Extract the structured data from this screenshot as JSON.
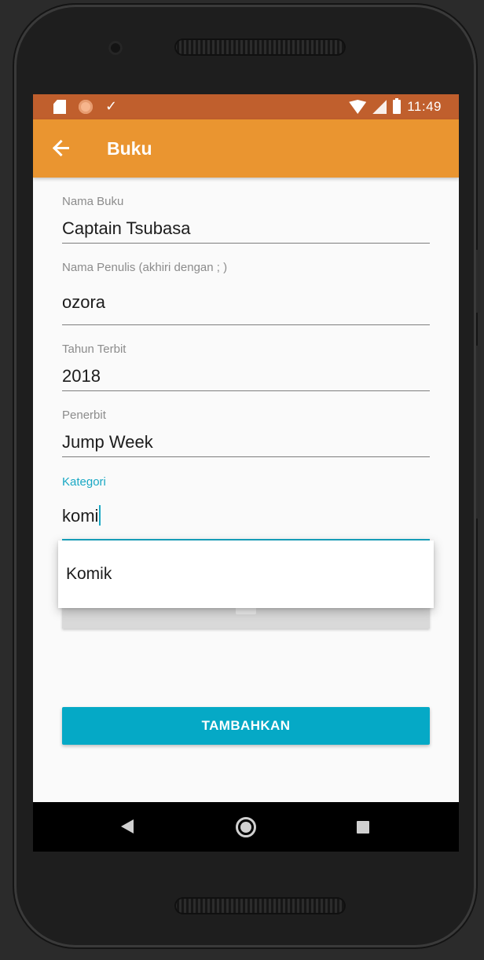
{
  "status_bar": {
    "time": "11:49",
    "icons": [
      "sd-card-icon",
      "sync-icon",
      "check-icon",
      "wifi-icon",
      "signal-icon",
      "battery-icon"
    ]
  },
  "app_bar": {
    "title": "Buku",
    "back_icon": "back-arrow-icon",
    "color": "#ea9530",
    "status_color": "#c05f2d"
  },
  "form": {
    "fields": [
      {
        "label": "Nama Buku",
        "value": "Captain Tsubasa"
      },
      {
        "label": "Nama Penulis (akhiri dengan ; )",
        "value": "ozora"
      },
      {
        "label": "Tahun Terbit",
        "value": "2018"
      },
      {
        "label": "Penerbit",
        "value": "Jump Week"
      },
      {
        "label": "Kategori",
        "value": "komi",
        "focused": true
      }
    ],
    "accent_color": "#19a8c4"
  },
  "autocomplete": {
    "suggestions": [
      "Komik"
    ]
  },
  "submit_button": {
    "label": "TAMBAHKAN",
    "color": "#05a9c6"
  },
  "nav_bar": {
    "icons": [
      "nav-back-icon",
      "nav-home-icon",
      "nav-recent-icon"
    ]
  }
}
